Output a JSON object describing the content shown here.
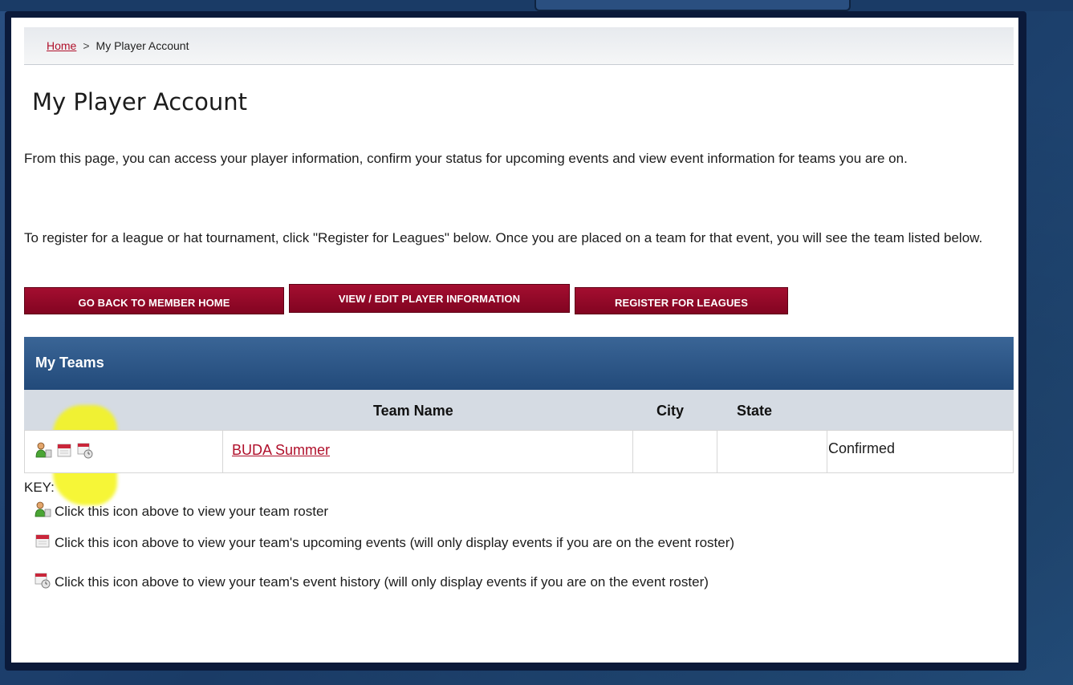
{
  "breadcrumb": {
    "home": "Home",
    "separator": ">",
    "current": "My Player Account"
  },
  "page": {
    "title": "My Player Account",
    "intro_1": "From this page, you can access your player information, confirm your status for upcoming events and view event information for teams you are on.",
    "intro_2": "To register for a league or hat tournament, click \"Register for Leagues\" below.  Once you are placed on a team for that event, you will see the team listed below."
  },
  "buttons": {
    "back": "GO BACK TO MEMBER HOME",
    "edit": "VIEW / EDIT PLAYER INFORMATION",
    "register": "REGISTER FOR LEAGUES"
  },
  "teams": {
    "title": "My Teams",
    "columns": {
      "team_name": "Team Name",
      "city": "City",
      "state": "State"
    },
    "rows": [
      {
        "team_name": "BUDA Summer",
        "city": "",
        "state": "",
        "status": "Confirmed",
        "icons": [
          "roster-icon",
          "upcoming-events-icon",
          "event-history-icon"
        ]
      }
    ]
  },
  "key": {
    "label": "KEY:",
    "items": [
      {
        "icon": "roster-icon",
        "text": "Click this icon above to view your team roster"
      },
      {
        "icon": "upcoming-events-icon",
        "text": "Click this icon above to view your team's upcoming events (will only display events if you are on the event roster)"
      },
      {
        "icon": "event-history-icon",
        "text": "Click this icon above to view your team's event history (will only display events if you are on the event roster)"
      }
    ]
  },
  "colors": {
    "button_red": "#9a0a2c",
    "link_red": "#b0102b",
    "header_blue": "#2b5585",
    "highlight_yellow": "#f5f514"
  }
}
